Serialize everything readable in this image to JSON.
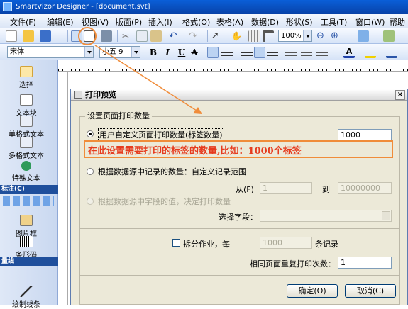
{
  "app": {
    "title": "SmartVizor Designer - [document.svt]"
  },
  "menu": [
    "文件(F)",
    "编辑(E)",
    "视图(V)",
    "版面(P)",
    "插入(I)",
    "格式(O)",
    "表格(A)",
    "数据(D)",
    "形状(S)",
    "工具(T)",
    "窗口(W)",
    "帮助"
  ],
  "toolbar": {
    "zoom": "100%",
    "font_name": "宋体",
    "font_size": "小五 9",
    "bold": "B",
    "italic": "I",
    "underline": "U",
    "strike": "A"
  },
  "left_panel": {
    "tools": [
      "选择",
      "文本块",
      "单格式文本",
      "多格式文本",
      "特殊文本",
      "图片框",
      "条形码",
      "绘制线条"
    ],
    "headers": [
      "标注(C)",
      "量线"
    ]
  },
  "dialog": {
    "title": "打印预览",
    "close": "×",
    "group_title": "设置页面打印数量",
    "option1_label": "用户自定义页面打印数量(标签数量)",
    "option1_value": "1000",
    "option2_label": "根据数据源中记录的数量：自定义记录范围",
    "from_label": "从(F)",
    "from_value": "1",
    "to_label": "到",
    "to_value": "10000000",
    "option3_label": "根据数据源中字段的值，决定打印数量",
    "select_field_label": "选择字段：",
    "split_label": "拆分作业，每",
    "split_value": "1000",
    "split_unit": "条记录",
    "repeat_label": "相同页面重复打印次数：",
    "repeat_value": "1",
    "ok": "确定(O)",
    "cancel": "取消(C)"
  },
  "annotation": {
    "text": "在此设置需要打印的标签的数量,比如：1000个标签",
    "color": "#e63b1e",
    "box_color": "#f08c3a"
  },
  "colors": {
    "titlebar": "#0a5fd8",
    "dialog_bg": "#ece9d8"
  }
}
